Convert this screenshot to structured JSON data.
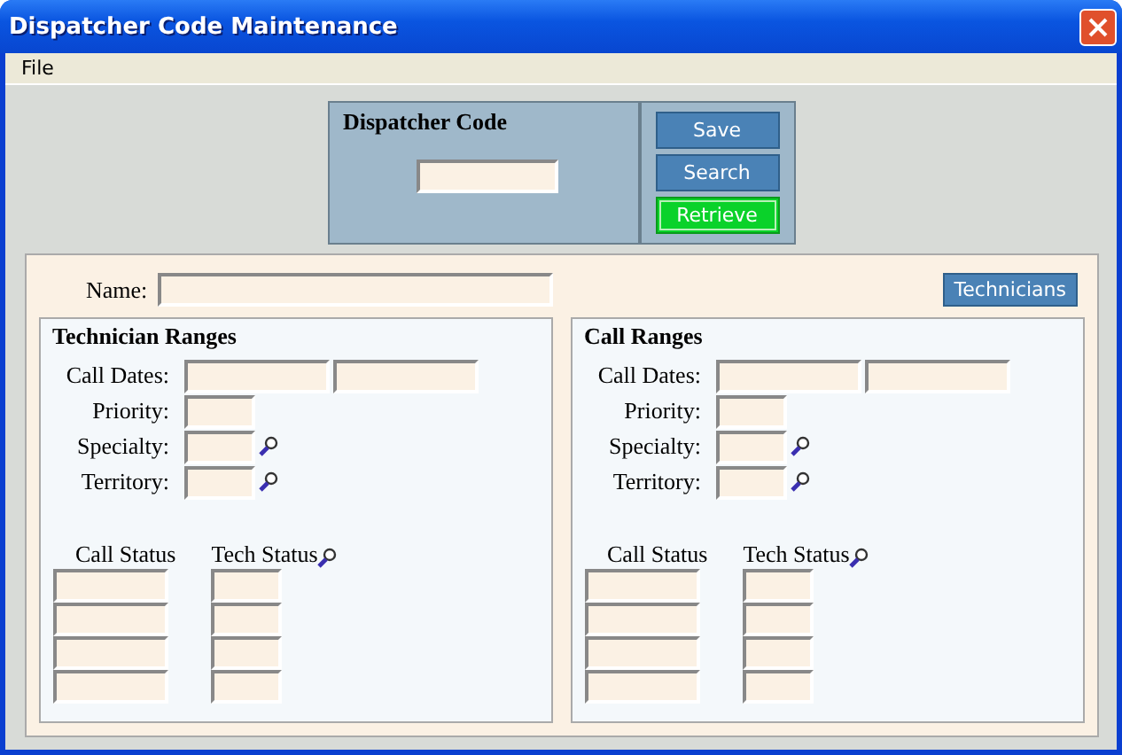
{
  "window": {
    "title": "Dispatcher Code Maintenance"
  },
  "menu": [
    "File"
  ],
  "dispatcher_code": {
    "label": "Dispatcher Code"
  },
  "buttons": [
    {
      "label": "Save",
      "highlighted": false
    },
    {
      "label": "Search",
      "highlighted": false
    },
    {
      "label": "Retrieve",
      "highlighted": true
    }
  ],
  "name_label": "Name:",
  "technicians_button": "Technicians",
  "panels": [
    {
      "title": "Technician Ranges",
      "fields": [
        {
          "label": "Call Dates:",
          "kind": "range"
        },
        {
          "label": "Priority:",
          "kind": "single"
        },
        {
          "label": "Specialty:",
          "kind": "lookup"
        },
        {
          "label": "Territory:",
          "kind": "lookup"
        }
      ],
      "call_status_label": "Call Status",
      "tech_status_label": "Tech Status"
    },
    {
      "title": "Call Ranges",
      "fields": [
        {
          "label": "Call Dates:",
          "kind": "range"
        },
        {
          "label": "Priority:",
          "kind": "single"
        },
        {
          "label": "Specialty:",
          "kind": "lookup"
        },
        {
          "label": "Territory:",
          "kind": "lookup"
        }
      ],
      "call_status_label": "Call Status",
      "tech_status_label": "Tech Status"
    }
  ]
}
